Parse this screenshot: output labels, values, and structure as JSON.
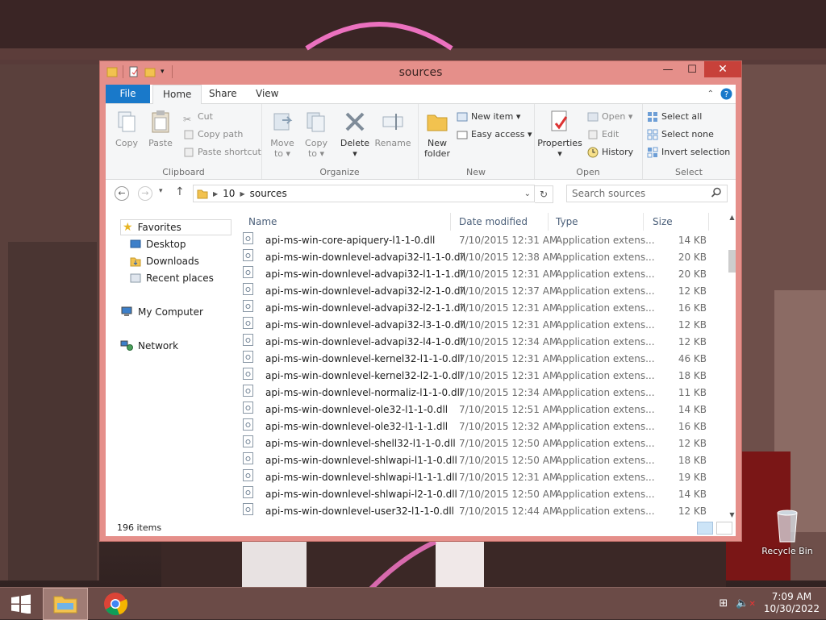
{
  "window": {
    "title": "sources",
    "controls": {
      "minimize": "—",
      "maximize": "☐",
      "close": "✕"
    }
  },
  "ribbon": {
    "tabs": {
      "file": "File",
      "home": "Home",
      "share": "Share",
      "view": "View"
    },
    "clipboard": {
      "label": "Clipboard",
      "copy": "Copy",
      "paste": "Paste",
      "cut": "Cut",
      "copy_path": "Copy path",
      "paste_shortcut": "Paste shortcut"
    },
    "organize": {
      "label": "Organize",
      "move_to": "Move to ▾",
      "copy_to": "Copy to ▾",
      "delete": "Delete ▾",
      "rename": "Rename"
    },
    "new": {
      "label": "New",
      "new_folder": "New folder",
      "new_item": "New item ▾",
      "easy_access": "Easy access ▾"
    },
    "open": {
      "label": "Open",
      "properties": "Properties ▾",
      "open": "Open ▾",
      "edit": "Edit",
      "history": "History"
    },
    "select": {
      "label": "Select",
      "select_all": "Select all",
      "select_none": "Select none",
      "invert_selection": "Invert selection"
    }
  },
  "address": {
    "segments": [
      "10",
      "sources"
    ],
    "search_placeholder": "Search sources"
  },
  "navpane": {
    "favorites": "Favorites",
    "desktop": "Desktop",
    "downloads": "Downloads",
    "recent": "Recent places",
    "computer": "My Computer",
    "network": "Network"
  },
  "columns": {
    "name": "Name",
    "date": "Date modified",
    "type": "Type",
    "size": "Size"
  },
  "files": [
    {
      "name": "api-ms-win-core-apiquery-l1-1-0.dll",
      "date": "7/10/2015 12:31 AM",
      "type": "Application extens...",
      "size": "14 KB"
    },
    {
      "name": "api-ms-win-downlevel-advapi32-l1-1-0.dll",
      "date": "7/10/2015 12:38 AM",
      "type": "Application extens...",
      "size": "20 KB"
    },
    {
      "name": "api-ms-win-downlevel-advapi32-l1-1-1.dll",
      "date": "7/10/2015 12:31 AM",
      "type": "Application extens...",
      "size": "20 KB"
    },
    {
      "name": "api-ms-win-downlevel-advapi32-l2-1-0.dll",
      "date": "7/10/2015 12:37 AM",
      "type": "Application extens...",
      "size": "12 KB"
    },
    {
      "name": "api-ms-win-downlevel-advapi32-l2-1-1.dll",
      "date": "7/10/2015 12:31 AM",
      "type": "Application extens...",
      "size": "16 KB"
    },
    {
      "name": "api-ms-win-downlevel-advapi32-l3-1-0.dll",
      "date": "7/10/2015 12:31 AM",
      "type": "Application extens...",
      "size": "12 KB"
    },
    {
      "name": "api-ms-win-downlevel-advapi32-l4-1-0.dll",
      "date": "7/10/2015 12:34 AM",
      "type": "Application extens...",
      "size": "12 KB"
    },
    {
      "name": "api-ms-win-downlevel-kernel32-l1-1-0.dll",
      "date": "7/10/2015 12:31 AM",
      "type": "Application extens...",
      "size": "46 KB"
    },
    {
      "name": "api-ms-win-downlevel-kernel32-l2-1-0.dll",
      "date": "7/10/2015 12:31 AM",
      "type": "Application extens...",
      "size": "18 KB"
    },
    {
      "name": "api-ms-win-downlevel-normaliz-l1-1-0.dll",
      "date": "7/10/2015 12:34 AM",
      "type": "Application extens...",
      "size": "11 KB"
    },
    {
      "name": "api-ms-win-downlevel-ole32-l1-1-0.dll",
      "date": "7/10/2015 12:51 AM",
      "type": "Application extens...",
      "size": "14 KB"
    },
    {
      "name": "api-ms-win-downlevel-ole32-l1-1-1.dll",
      "date": "7/10/2015 12:32 AM",
      "type": "Application extens...",
      "size": "16 KB"
    },
    {
      "name": "api-ms-win-downlevel-shell32-l1-1-0.dll",
      "date": "7/10/2015 12:50 AM",
      "type": "Application extens...",
      "size": "12 KB"
    },
    {
      "name": "api-ms-win-downlevel-shlwapi-l1-1-0.dll",
      "date": "7/10/2015 12:50 AM",
      "type": "Application extens...",
      "size": "18 KB"
    },
    {
      "name": "api-ms-win-downlevel-shlwapi-l1-1-1.dll",
      "date": "7/10/2015 12:31 AM",
      "type": "Application extens...",
      "size": "19 KB"
    },
    {
      "name": "api-ms-win-downlevel-shlwapi-l2-1-0.dll",
      "date": "7/10/2015 12:50 AM",
      "type": "Application extens...",
      "size": "14 KB"
    },
    {
      "name": "api-ms-win-downlevel-user32-l1-1-0.dll",
      "date": "7/10/2015 12:44 AM",
      "type": "Application extens...",
      "size": "12 KB"
    }
  ],
  "status": {
    "item_count": "196 items"
  },
  "desktop": {
    "recycle_bin": "Recycle Bin"
  },
  "taskbar": {
    "time": "7:09 AM",
    "date": "10/30/2022"
  },
  "colors": {
    "window_frame": "#e58f8a",
    "close_button": "#c7413a",
    "file_tab": "#1979ca",
    "taskbar": "#6b4b47"
  }
}
